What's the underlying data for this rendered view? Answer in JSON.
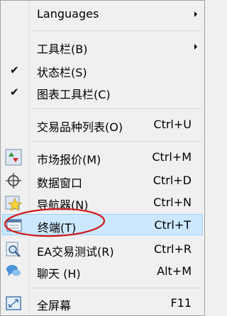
{
  "menu": {
    "items": [
      {
        "label": "Languages",
        "has_submenu": true
      },
      {
        "label": "工具栏(B)",
        "has_submenu": true
      },
      {
        "label": "状态栏(S)",
        "checked": true
      },
      {
        "label": "图表工具栏(C)",
        "checked": true
      },
      {
        "label": "交易品种列表(O)",
        "shortcut": "Ctrl+U"
      },
      {
        "label": "市场报价(M)",
        "shortcut": "Ctrl+M",
        "icon": "market-watch-icon"
      },
      {
        "label": "数据窗口",
        "shortcut": "Ctrl+D",
        "icon": "crosshair-icon"
      },
      {
        "label": "导航器(N)",
        "shortcut": "Ctrl+N",
        "icon": "navigator-star-icon"
      },
      {
        "label": "终端(T)",
        "shortcut": "Ctrl+T",
        "icon": "terminal-icon",
        "highlighted": true
      },
      {
        "label": "EA交易测试(R)",
        "shortcut": "Ctrl+R",
        "icon": "tester-magnifier-icon"
      },
      {
        "label": "聊天 (H)",
        "shortcut": "Alt+M",
        "icon": "chat-icon"
      },
      {
        "label": "全屏幕",
        "shortcut": "F11",
        "icon": "fullscreen-icon"
      }
    ],
    "check_glyph": "✔",
    "highlight_color": "#cce8ff",
    "annotation_color": "#d01818"
  }
}
